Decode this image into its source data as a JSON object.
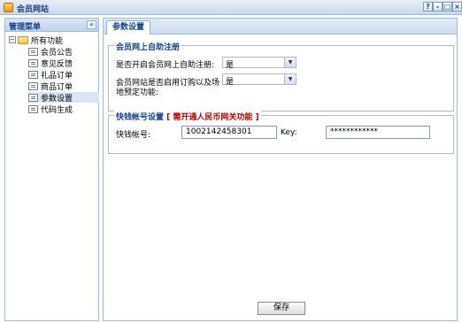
{
  "window": {
    "title": "会员网站",
    "help": "?",
    "minimize": "–",
    "maximize": "□",
    "close": "×"
  },
  "sidebar": {
    "title": "管理菜单",
    "collapse": "«",
    "root": {
      "label": "所有功能",
      "toggle": "−"
    },
    "items": [
      {
        "label": "会员公告"
      },
      {
        "label": "意见反馈"
      },
      {
        "label": "礼品订单"
      },
      {
        "label": "商品订单"
      },
      {
        "label": "参数设置",
        "selected": true
      },
      {
        "label": "代码生成"
      }
    ]
  },
  "main": {
    "tab": "参数设置",
    "registration": {
      "legend": "会员网上自助注册",
      "fields": [
        {
          "label": "是否开启会员网上自助注册:",
          "value": "是"
        },
        {
          "label_line1": "会员网站是否启用订购以及场",
          "label_line2": "地预定功能:",
          "value": "是"
        }
      ]
    },
    "kuaiqian": {
      "legend": "快钱帐号设置",
      "legend_warning": "[ 需开通人民币网关功能 ]",
      "account_label": "快钱帐号:",
      "account_value": "1002142458301",
      "key_label": "Key:",
      "key_value": "************"
    },
    "save_label": "保存"
  }
}
